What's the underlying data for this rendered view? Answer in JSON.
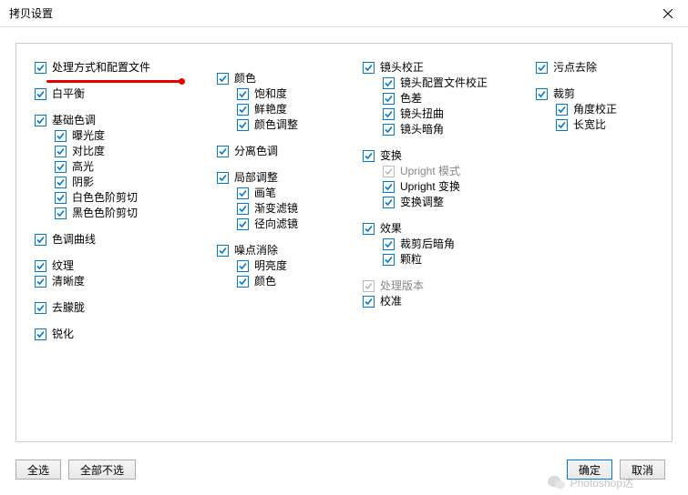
{
  "title": "拷贝设置",
  "columns": {
    "col1": [
      {
        "type": "item",
        "label": "处理方式和配置文件",
        "checked": true,
        "redline": true,
        "key": "process-mode-profile"
      },
      {
        "type": "spacer"
      },
      {
        "type": "item",
        "label": "白平衡",
        "checked": true,
        "key": "white-balance"
      },
      {
        "type": "spacer"
      },
      {
        "type": "item",
        "label": "基础色调",
        "checked": true,
        "key": "basic-tone"
      },
      {
        "type": "sub",
        "label": "曝光度",
        "checked": true,
        "key": "exposure"
      },
      {
        "type": "sub",
        "label": "对比度",
        "checked": true,
        "key": "contrast"
      },
      {
        "type": "sub",
        "label": "高光",
        "checked": true,
        "key": "highlights"
      },
      {
        "type": "sub",
        "label": "阴影",
        "checked": true,
        "key": "shadows"
      },
      {
        "type": "sub",
        "label": "白色色阶剪切",
        "checked": true,
        "key": "white-clip"
      },
      {
        "type": "sub",
        "label": "黑色色阶剪切",
        "checked": true,
        "key": "black-clip"
      },
      {
        "type": "spacer"
      },
      {
        "type": "item",
        "label": "色调曲线",
        "checked": true,
        "key": "tone-curve"
      },
      {
        "type": "spacer"
      },
      {
        "type": "item",
        "label": "纹理",
        "checked": true,
        "key": "texture"
      },
      {
        "type": "item",
        "label": "清晰度",
        "checked": true,
        "key": "clarity"
      },
      {
        "type": "spacer"
      },
      {
        "type": "item",
        "label": "去朦胧",
        "checked": true,
        "key": "dehaze"
      },
      {
        "type": "spacer"
      },
      {
        "type": "item",
        "label": "锐化",
        "checked": true,
        "key": "sharpen"
      }
    ],
    "col2": [
      {
        "type": "spacer"
      },
      {
        "type": "item",
        "label": "颜色",
        "checked": true,
        "key": "color"
      },
      {
        "type": "sub",
        "label": "饱和度",
        "checked": true,
        "key": "saturation"
      },
      {
        "type": "sub",
        "label": "鲜艳度",
        "checked": true,
        "key": "vibrance"
      },
      {
        "type": "sub",
        "label": "颜色调整",
        "checked": true,
        "key": "color-adjust"
      },
      {
        "type": "spacer"
      },
      {
        "type": "item",
        "label": "分离色调",
        "checked": true,
        "key": "split-tone"
      },
      {
        "type": "spacer"
      },
      {
        "type": "item",
        "label": "局部调整",
        "checked": true,
        "key": "local-adjust"
      },
      {
        "type": "sub",
        "label": "画笔",
        "checked": true,
        "key": "brush"
      },
      {
        "type": "sub",
        "label": "渐变滤镜",
        "checked": true,
        "key": "gradient-filter"
      },
      {
        "type": "sub",
        "label": "径向滤镜",
        "checked": true,
        "key": "radial-filter"
      },
      {
        "type": "spacer"
      },
      {
        "type": "item",
        "label": "噪点消除",
        "checked": true,
        "key": "noise-reduction"
      },
      {
        "type": "sub",
        "label": "明亮度",
        "checked": true,
        "key": "luminance"
      },
      {
        "type": "sub",
        "label": "颜色",
        "checked": true,
        "key": "nr-color"
      }
    ],
    "col3": [
      {
        "type": "item",
        "label": "镜头校正",
        "checked": true,
        "key": "lens-correction"
      },
      {
        "type": "sub",
        "label": "镜头配置文件校正",
        "checked": true,
        "key": "lens-profile"
      },
      {
        "type": "sub",
        "label": "色差",
        "checked": true,
        "key": "chromatic"
      },
      {
        "type": "sub",
        "label": "镜头扭曲",
        "checked": true,
        "key": "lens-distortion"
      },
      {
        "type": "sub",
        "label": "镜头暗角",
        "checked": true,
        "key": "lens-vignette"
      },
      {
        "type": "spacer"
      },
      {
        "type": "item",
        "label": "变换",
        "checked": true,
        "key": "transform"
      },
      {
        "type": "sub",
        "label": "Upright 模式",
        "checked": true,
        "disabled": true,
        "key": "upright-mode"
      },
      {
        "type": "sub",
        "label": "Upright 变换",
        "checked": true,
        "key": "upright-transform"
      },
      {
        "type": "sub",
        "label": "变换调整",
        "checked": true,
        "key": "transform-adjust"
      },
      {
        "type": "spacer"
      },
      {
        "type": "item",
        "label": "效果",
        "checked": true,
        "key": "effects"
      },
      {
        "type": "sub",
        "label": "裁剪后暗角",
        "checked": true,
        "key": "post-crop-vignette"
      },
      {
        "type": "sub",
        "label": "颗粒",
        "checked": true,
        "key": "grain"
      },
      {
        "type": "spacer"
      },
      {
        "type": "item",
        "label": "处理版本",
        "checked": true,
        "disabled": true,
        "key": "process-version"
      },
      {
        "type": "item",
        "label": "校准",
        "checked": true,
        "key": "calibration"
      }
    ],
    "col4": [
      {
        "type": "item",
        "label": "污点去除",
        "checked": true,
        "key": "spot-removal"
      },
      {
        "type": "spacer"
      },
      {
        "type": "item",
        "label": "裁剪",
        "checked": true,
        "key": "crop"
      },
      {
        "type": "sub",
        "label": "角度校正",
        "checked": true,
        "key": "angle"
      },
      {
        "type": "sub",
        "label": "长宽比",
        "checked": true,
        "key": "aspect-ratio"
      }
    ]
  },
  "footer": {
    "select_all": "全选",
    "select_none": "全部不选",
    "ok": "确定",
    "cancel": "取消"
  },
  "watermark": "Photoshop达"
}
